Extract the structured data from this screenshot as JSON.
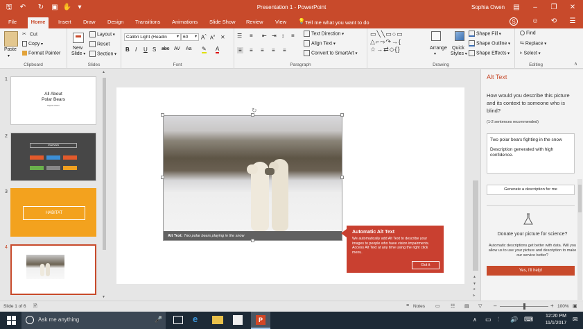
{
  "window": {
    "title": "Presentation 1 - PowerPoint",
    "user": "Sophia Owen"
  },
  "tabs": [
    "File",
    "Home",
    "Insert",
    "Draw",
    "Design",
    "Transitions",
    "Animations",
    "Slide Show",
    "Review",
    "View"
  ],
  "active_tab": "Home",
  "tell_me": "Tell me what you want to do",
  "ribbon": {
    "clipboard": {
      "label": "Clipboard",
      "paste": "Paste",
      "cut": "Cut",
      "copy": "Copy",
      "format_painter": "Format Painter"
    },
    "slides": {
      "label": "Slides",
      "new_slide": "New",
      "new_slide2": "Slide",
      "layout": "Layout",
      "reset": "Reset",
      "section": "Section"
    },
    "font": {
      "label": "Font",
      "font_name": "Calibri Light (Headin",
      "font_size": "60"
    },
    "paragraph": {
      "label": "Paragraph",
      "text_direction": "Text Direction",
      "align_text": "Align Text",
      "convert_smartart": "Convert to SmartArt"
    },
    "drawing": {
      "label": "Drawing",
      "arrange": "Arrange",
      "quick_styles": "Quick",
      "quick_styles2": "Styles",
      "shape_fill": "Shape Fill",
      "shape_outline": "Shape Outline",
      "shape_effects": "Shape Effects"
    },
    "editing": {
      "label": "Editing",
      "find": "Find",
      "replace": "Replace",
      "select": "Select"
    }
  },
  "slides": [
    {
      "num": "1",
      "title1": "All About",
      "title2": "Polar Bears",
      "subtitle": "Sophia Owen"
    },
    {
      "num": "2",
      "header": "OVERVIEW"
    },
    {
      "num": "3",
      "header": "HABITAT"
    },
    {
      "num": "4"
    }
  ],
  "canvas": {
    "alt_caption_label": "Alt Text:",
    "alt_caption_text": "Two polar bears playing in the snow"
  },
  "callout": {
    "title": "Automatic Alt Text",
    "body": "We automatically add Alt Text to describe your images to people who have vision impairments. Access Alt Text at any time using the right click menu.",
    "button": "Got it"
  },
  "alt_pane": {
    "title": "Alt Text",
    "question": "How would you describe this picture and its context to someone who is blind?",
    "hint": "(1-2 sentences recommended)",
    "description": "Two polar bears fighting in the snow",
    "generated": "Description generated with high confidence.",
    "generate_button": "Generate a description for me",
    "donate_title": "Donate your picture for science?",
    "donate_body": "Automatic descriptions get better with data. Will you allow us to use your picture and description to make our service better?",
    "yes_button": "Yes, I'll help!"
  },
  "status": {
    "slide_of": "Slide 1 of 6",
    "notes": "Notes",
    "zoom": "100%"
  },
  "taskbar": {
    "search": "Ask me anything",
    "time": "12:20 PM",
    "date": "11/1/2017"
  },
  "colors": {
    "accent": "#c84a2b",
    "callout": "#c94030",
    "slide3": "#f3a21e",
    "slide2": "#474747"
  }
}
